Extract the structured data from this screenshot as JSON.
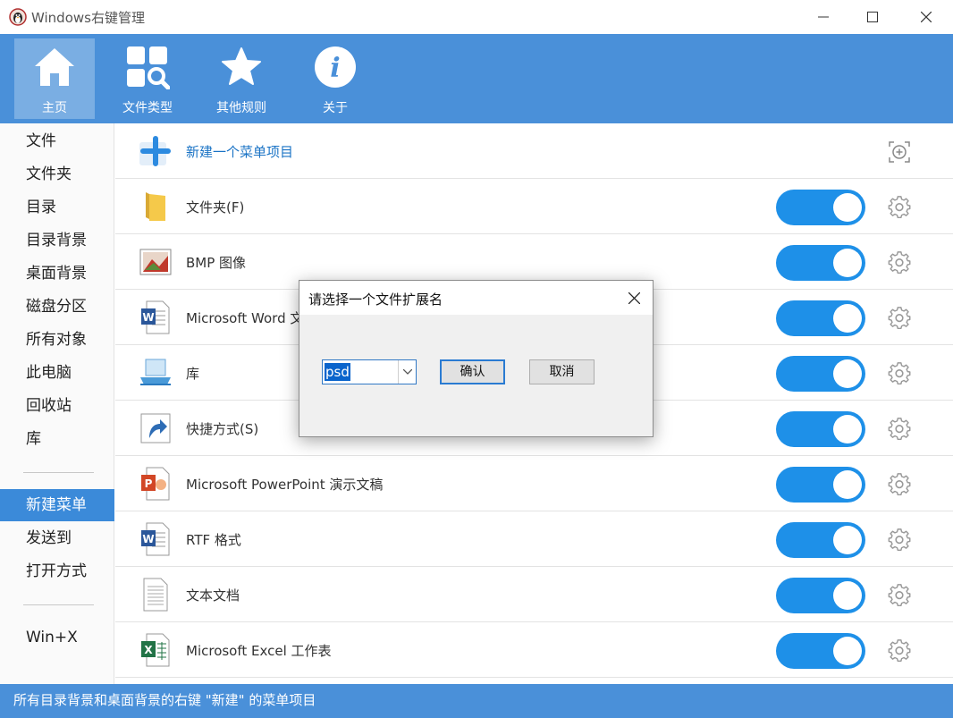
{
  "window": {
    "title": "Windows右键管理"
  },
  "toolbar": {
    "items": [
      {
        "label": "主页",
        "icon": "home-icon"
      },
      {
        "label": "文件类型",
        "icon": "file-types-icon"
      },
      {
        "label": "其他规则",
        "icon": "star-icon"
      },
      {
        "label": "关于",
        "icon": "info-icon"
      }
    ],
    "active_index": 0
  },
  "sidebar": {
    "items": [
      "文件",
      "文件夹",
      "目录",
      "目录背景",
      "桌面背景",
      "磁盘分区",
      "所有对象",
      "此电脑",
      "回收站",
      "库",
      "新建菜单",
      "发送到",
      "打开方式",
      "Win+X"
    ],
    "active": "新建菜单"
  },
  "main": {
    "new_item_label": "新建一个菜单项目",
    "rows": [
      {
        "label": "文件夹(F)",
        "icon": "folder-icon",
        "enabled": true
      },
      {
        "label": "BMP 图像",
        "icon": "bmp-image-icon",
        "enabled": true
      },
      {
        "label": "Microsoft Word 文档",
        "icon": "word-doc-icon",
        "enabled": true
      },
      {
        "label": "库",
        "icon": "library-icon",
        "enabled": true
      },
      {
        "label": "快捷方式(S)",
        "icon": "shortcut-icon",
        "enabled": true
      },
      {
        "label": "Microsoft PowerPoint 演示文稿",
        "icon": "powerpoint-icon",
        "enabled": true
      },
      {
        "label": "RTF 格式",
        "icon": "rtf-doc-icon",
        "enabled": true
      },
      {
        "label": "文本文档",
        "icon": "text-doc-icon",
        "enabled": true
      },
      {
        "label": "Microsoft Excel 工作表",
        "icon": "excel-icon",
        "enabled": true
      }
    ]
  },
  "statusbar": {
    "text": "所有目录背景和桌面背景的右键 \"新建\" 的菜单项目"
  },
  "dialog": {
    "title": "请选择一个文件扩展名",
    "extension_value": "psd",
    "confirm_label": "确认",
    "cancel_label": "取消"
  },
  "colors": {
    "accent": "#4a90d9",
    "toggle_on": "#1e90e8",
    "selected": "#3b8ad9"
  }
}
